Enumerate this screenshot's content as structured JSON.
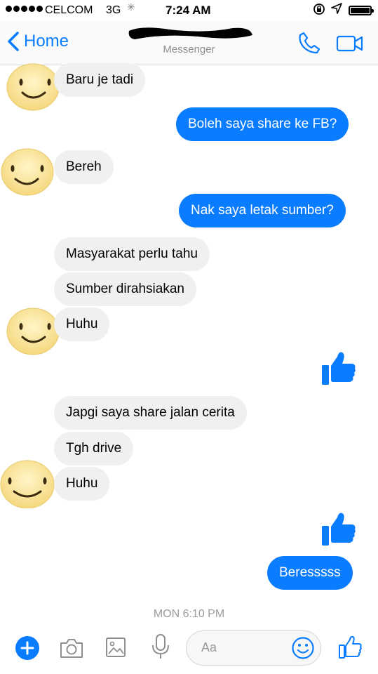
{
  "status_bar": {
    "carrier": "CELCOM",
    "network": "3G",
    "time": "7:24 AM"
  },
  "header": {
    "back_label": "Home",
    "subtitle": "Messenger"
  },
  "messages": [
    {
      "side": "left",
      "text": "Baru je tadi"
    },
    {
      "side": "right",
      "text": "Boleh saya share ke FB?"
    },
    {
      "side": "left",
      "text": "Bereh"
    },
    {
      "side": "right",
      "text": "Nak saya letak sumber?"
    },
    {
      "side": "left",
      "text": "Masyarakat perlu tahu"
    },
    {
      "side": "left",
      "text": "Sumber dirahsiakan"
    },
    {
      "side": "left",
      "text": "Huhu"
    },
    {
      "side": "right",
      "type": "like"
    },
    {
      "side": "left",
      "text": "Japgi saya share jalan cerita"
    },
    {
      "side": "left",
      "text": "Tgh drive"
    },
    {
      "side": "left",
      "text": "Huhu"
    },
    {
      "side": "right",
      "type": "like"
    },
    {
      "side": "right",
      "text": "Beresssss"
    }
  ],
  "timestamp": "MON 6:10 PM",
  "composer": {
    "placeholder": "Aa"
  },
  "colors": {
    "accent": "#0a7cff",
    "incoming_bubble": "#f1f0f0",
    "outgoing_bubble": "#0a7cff"
  }
}
